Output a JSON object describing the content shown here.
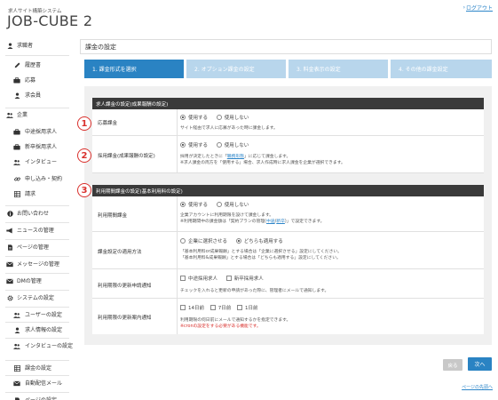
{
  "header": {
    "brand_subtitle": "求人サイト構築システム",
    "brand": "JOB-CUBE 2",
    "logout": "ログアウト"
  },
  "sidebar": {
    "items": [
      {
        "label": "求職者",
        "icon": "user-icon",
        "level": "top"
      },
      {
        "label": "履歴書",
        "icon": "pencil-icon",
        "level": "sub"
      },
      {
        "label": "応募",
        "icon": "briefcase-icon",
        "level": "sub"
      },
      {
        "label": "求会員",
        "icon": "user-icon",
        "level": "sub"
      },
      {
        "label": "企業",
        "icon": "users-icon",
        "level": "top"
      },
      {
        "label": "中途採用求人",
        "icon": "briefcase-icon",
        "level": "sub"
      },
      {
        "label": "新卒採用求人",
        "icon": "briefcase-icon",
        "level": "sub"
      },
      {
        "label": "インタビュー",
        "icon": "users-icon",
        "level": "sub"
      },
      {
        "label": "申し込み・契約",
        "icon": "link-icon",
        "level": "sub"
      },
      {
        "label": "請求",
        "icon": "table-icon",
        "level": "sub"
      },
      {
        "label": "お問い合わせ",
        "icon": "info-icon",
        "level": "top"
      },
      {
        "label": "ニュースの管理",
        "icon": "megaphone-icon",
        "level": "top"
      },
      {
        "label": "ページの管理",
        "icon": "file-icon",
        "level": "top"
      },
      {
        "label": "メッセージの管理",
        "icon": "mail-icon",
        "level": "top"
      },
      {
        "label": "DMの管理",
        "icon": "mail-icon",
        "level": "top"
      },
      {
        "label": "システムの設定",
        "icon": "gear-icon",
        "level": "top"
      },
      {
        "label": "ユーザーの設定",
        "icon": "users-icon",
        "level": "sub"
      },
      {
        "label": "求人情報の設定",
        "icon": "user-icon",
        "level": "sub"
      },
      {
        "label": "インタビューの設定",
        "icon": "users-icon",
        "level": "sub"
      },
      {
        "label": "課金の設定",
        "icon": "table-icon",
        "level": "sub"
      },
      {
        "label": "自動配信メール",
        "icon": "mail-icon",
        "level": "sub"
      },
      {
        "label": "ページの設定",
        "icon": "file-icon",
        "level": "sub"
      }
    ]
  },
  "page_title": "課金の設定",
  "steps": [
    {
      "label": "1. 課金形式を選択",
      "active": true
    },
    {
      "label": "2. オプション課金の設定",
      "active": false
    },
    {
      "label": "3. 料金表示の設定",
      "active": false
    },
    {
      "label": "4. その他の課金設定",
      "active": false
    }
  ],
  "section1": {
    "title": "求人課金の設定(成果報酬の設定)",
    "rows": [
      {
        "label": "応募課金",
        "options": [
          "使用する",
          "使用しない"
        ],
        "selected": 0,
        "note": "サイト経由で求人に応募があった時に課金します。"
      },
      {
        "label": "採用課金(成果報酬の設定)",
        "options": [
          "使用する",
          "使用しない"
        ],
        "selected": 0,
        "note1_pre": "採用が決定したときに「",
        "note1_link": "職務形態",
        "note1_post": "」に応じて課金します。",
        "note2": "※求人課金の両方を「使用する」場合、求人作成時に求人課金を企業が選択できます。"
      }
    ]
  },
  "section2": {
    "title": "利用期間課金の設定(基本利用料の設定)",
    "rows": [
      {
        "label": "利用期間課金",
        "options": [
          "使用する",
          "使用しない"
        ],
        "selected": 0,
        "note1": "企業アカウントに利用期限を設けて課金します。",
        "note2_pre": "※利用期間中の課金額は「契約プランの管理(",
        "note2_link1": "中途",
        "note2_mid": "/",
        "note2_link2": "新卒",
        "note2_post": ")」で設定できます。"
      },
      {
        "label": "課金設定の適用方法",
        "options": [
          "企業に選択させる",
          "どちらも適用する"
        ],
        "selected": 1,
        "note1": "「基本利用料or成果報酬」とする場合は「企業に選択させる」設定にしてください。",
        "note2": "「基本利用料&成果報酬」とする場合は「どちらも適用する」設定にしてください。"
      },
      {
        "label": "利用期限の更新申請通知",
        "checks": [
          "中途採用求人",
          "新卒採用求人"
        ],
        "note1": "チェックを入れると更新の申請があった際に、管理者にメールで通知します。"
      },
      {
        "label": "利用期限の更新案内通知",
        "checks": [
          "14日前",
          "7日前",
          "1日前"
        ],
        "note1": "利用期限の何日前にメールで通知するかを指定できます。",
        "note2": "※cronの設定をする必要がある機能です。"
      }
    ]
  },
  "badges": [
    "1",
    "2",
    "3"
  ],
  "buttons": {
    "back": "戻る",
    "next": "次へ"
  },
  "first_link": "ページの先頭へ",
  "colors": {
    "accent": "#2a83c3",
    "step_inactive": "#b8d6ec",
    "badge": "#d9302c",
    "section_head": "#3a3a3a"
  }
}
